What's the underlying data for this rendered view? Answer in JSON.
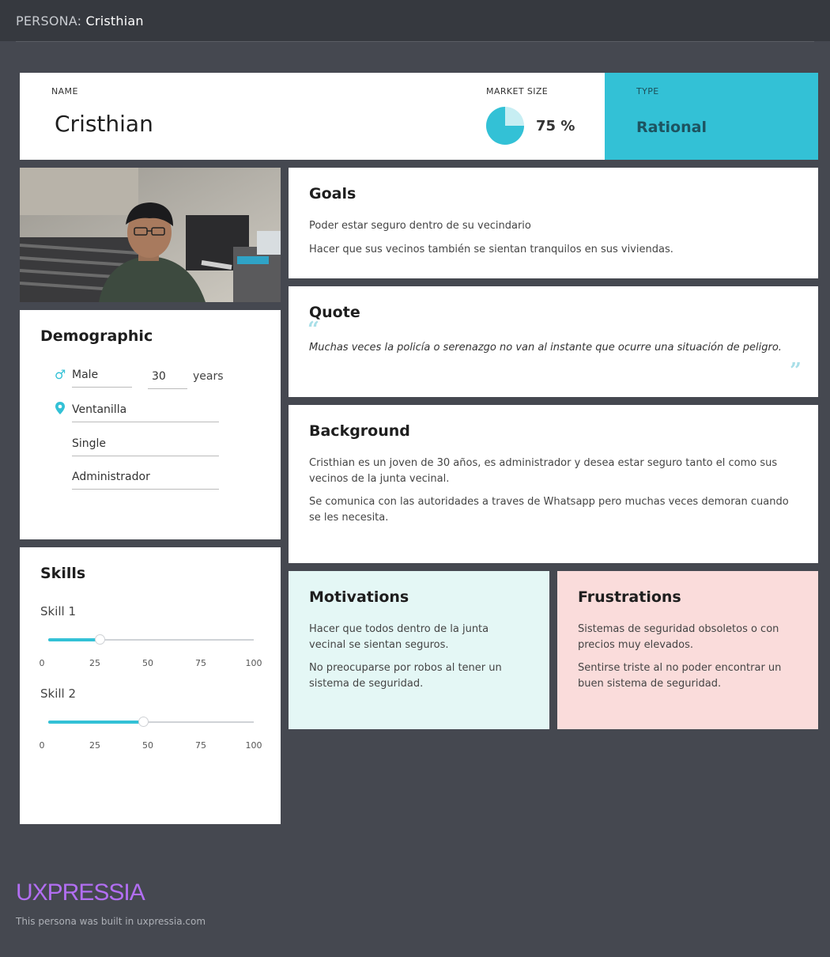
{
  "topbar": {
    "prefix": "PERSONA:",
    "name": "Cristhian"
  },
  "header": {
    "name_label": "NAME",
    "name": "Cristhian",
    "market_label": "MARKET SIZE",
    "market_value_text": "75 %",
    "market_fraction": 0.75,
    "type_label": "TYPE",
    "type_value": "Rational"
  },
  "demographic": {
    "title": "Demographic",
    "gender": "Male",
    "age": "30",
    "age_unit": "years",
    "location": "Ventanilla",
    "status": "Single",
    "occupation": "Administrador",
    "gender_icon": "male-icon",
    "location_icon": "map-pin-icon"
  },
  "skills": {
    "title": "Skills",
    "ticks": [
      "0",
      "25",
      "50",
      "75",
      "100"
    ],
    "items": [
      {
        "label": "Skill 1",
        "value": 25
      },
      {
        "label": "Skill 2",
        "value": 46
      }
    ]
  },
  "goals": {
    "title": "Goals",
    "lines": [
      "Poder estar seguro dentro de su vecindario",
      "Hacer que sus vecinos también se sientan tranquilos en sus viviendas."
    ]
  },
  "quote": {
    "title": "Quote",
    "text": "Muchas veces la policía o serenazgo no van al instante que ocurre una situación de peligro.",
    "open_mark": "“",
    "close_mark": "”"
  },
  "background": {
    "title": "Background",
    "paragraphs": [
      "Cristhian es un joven de 30 años, es administrador y desea estar seguro tanto el como sus vecinos de la junta vecinal.",
      "Se comunica con las autoridades a traves de Whatsapp pero muchas veces demoran cuando se les necesita."
    ]
  },
  "motivations": {
    "title": "Motivations",
    "items": [
      "Hacer que todos dentro de la junta vecinal se sientan seguros.",
      "No preocuparse por robos al tener un sistema de seguridad."
    ]
  },
  "frustrations": {
    "title": "Frustrations",
    "items": [
      "Sistemas de seguridad obsoletos o con precios muy elevados.",
      "Sentirse triste al no poder encontrar un buen sistema de seguridad."
    ]
  },
  "footer": {
    "brand": "UXPRESSIA",
    "note": "This persona was built in uxpressia.com"
  },
  "colors": {
    "accent": "#33c1d6",
    "page_bg": "#454850",
    "motivations_bg": "#e4f7f5",
    "frustrations_bg": "#fadcdb",
    "brand": "#b26ef2"
  }
}
